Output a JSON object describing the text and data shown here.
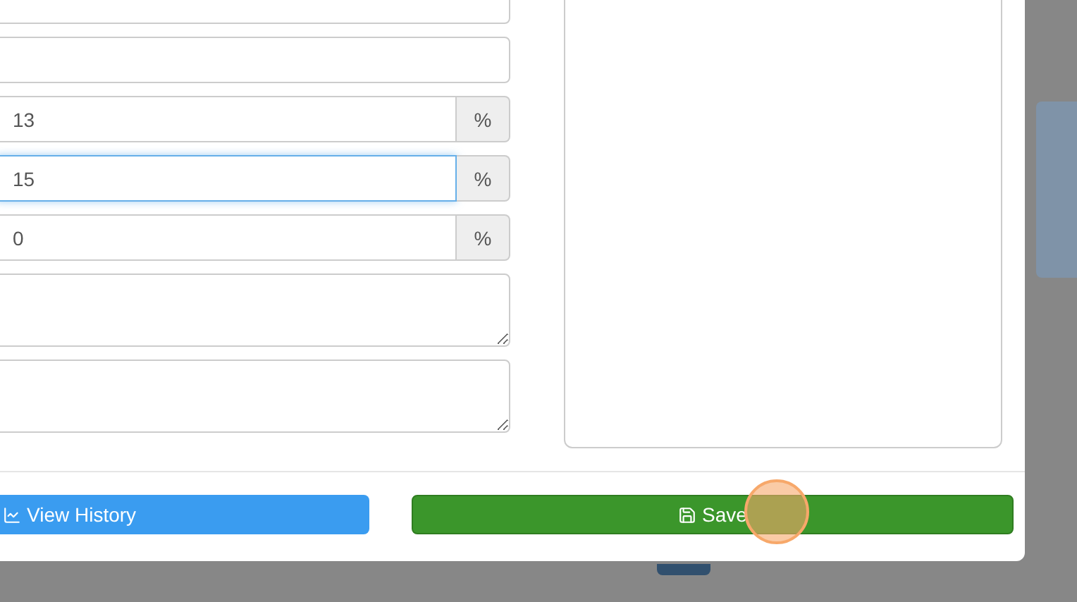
{
  "fields": [
    {
      "kind": "text",
      "focused": false
    },
    {
      "kind": "text",
      "focused": false
    },
    {
      "kind": "percent",
      "value": "13",
      "addon": "%",
      "focused": false
    },
    {
      "kind": "percent",
      "value": "15",
      "addon": "%",
      "focused": true
    },
    {
      "kind": "percent",
      "value": "0",
      "addon": "%",
      "focused": false
    },
    {
      "kind": "textarea",
      "focused": false
    },
    {
      "kind": "textarea",
      "focused": false
    }
  ],
  "buttons": [
    {
      "kind": "history",
      "label": "View History"
    },
    {
      "kind": "save",
      "label": "Save"
    }
  ]
}
